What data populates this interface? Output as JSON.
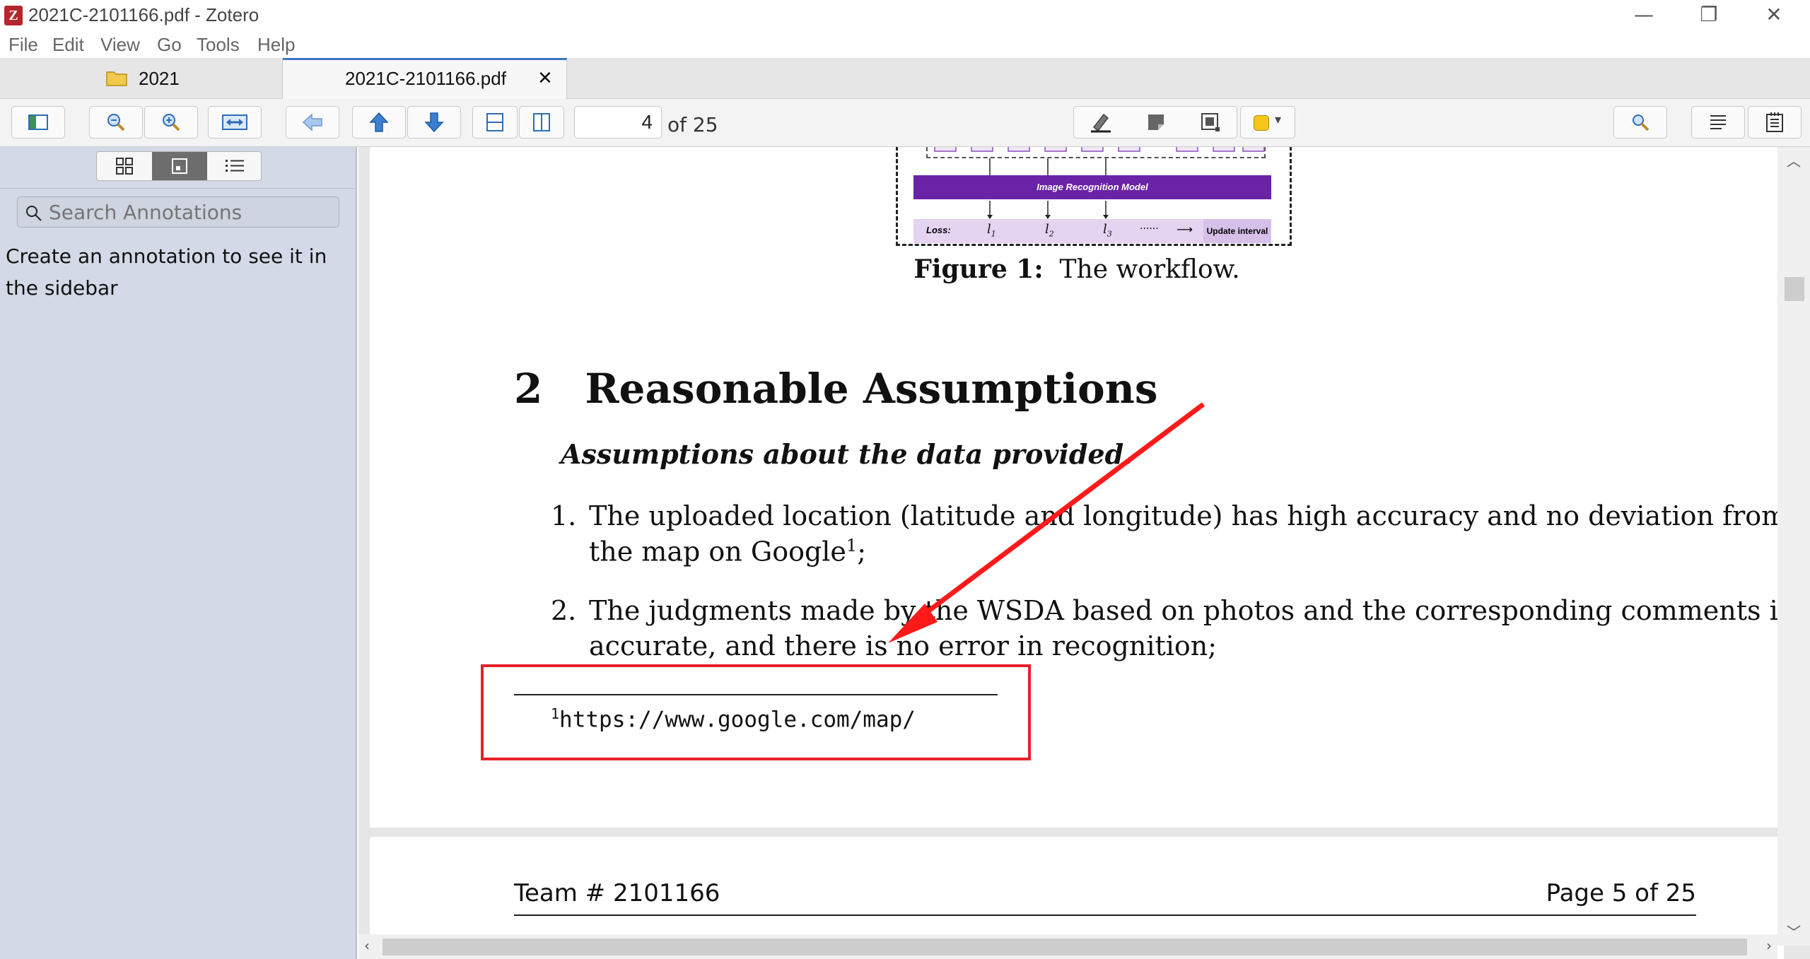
{
  "window": {
    "title": "2021C-2101166.pdf - Zotero",
    "app_icon_letter": "Z",
    "minimize_glyph": "—",
    "restore_glyph": "❐",
    "close_glyph": "✕"
  },
  "menu": [
    "File",
    "Edit",
    "View",
    "Go",
    "Tools",
    "Help"
  ],
  "tabs": [
    {
      "label": "2021",
      "icon": "folder-icon",
      "active": false
    },
    {
      "label": "2021C-2101166.pdf",
      "active": true,
      "close_glyph": "✕"
    }
  ],
  "toolbar": {
    "current_page": "4",
    "page_count_text": "of 25",
    "highlight_color": "#f5c518"
  },
  "sidebar": {
    "search_placeholder": "Search Annotations",
    "empty_message": "Create an annotation to see it in the sidebar"
  },
  "document": {
    "figure_model_label": "Image Recognition Model",
    "figure_loss_label": "Loss:",
    "figure_l1": "l",
    "figure_l1_sub": "1",
    "figure_l2": "l",
    "figure_l2_sub": "2",
    "figure_l3": "l",
    "figure_l3_sub": "3",
    "figure_dots": "······",
    "figure_update_label": "Update interval",
    "figure_caption_bold": "Figure 1:",
    "figure_caption_text": "The workflow.",
    "section_number": "2",
    "section_title": "Reasonable Assumptions",
    "subheading": "Assumptions about the data provided.",
    "item1_number": "1.",
    "item1_line1": "The uploaded location (latitude and longitude) has high accuracy and no deviation from",
    "item1_line2": "the map on Google",
    "item1_sup": "1",
    "item1_tail": ";",
    "item2_number": "2.",
    "item2_line1": "The judgments made by the WSDA based on photos and the corresponding comments is",
    "item2_line2": "accurate, and there is no error in recognition;",
    "footnote_mark": "1",
    "footnote_url": "https://www.google.com/map/",
    "next_header_left": "Team # 2101166",
    "next_header_right": "Page 5 of 25"
  },
  "annotation_colors": {
    "arrow": "#ff1a1a",
    "box": "#e8202a"
  }
}
